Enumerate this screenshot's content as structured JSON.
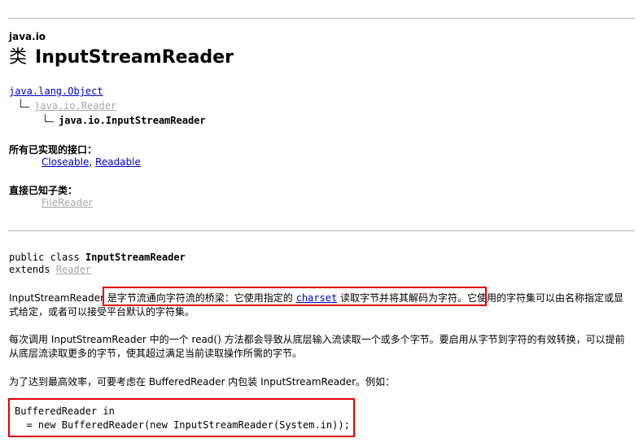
{
  "header": {
    "package": "java.io",
    "kind": "类",
    "class_name": "InputStreamReader"
  },
  "hierarchy": {
    "level1": "java.lang.Object",
    "level2": "java.io.Reader",
    "level3": "java.io.InputStreamReader"
  },
  "interfaces": {
    "label": "所有已实现的接口：",
    "items": [
      "Closeable",
      "Readable"
    ],
    "separator": ", "
  },
  "subclasses": {
    "label": "直接已知子类：",
    "items": [
      "FileReader"
    ]
  },
  "signature": {
    "line1_prefix": "public class ",
    "line1_name": "InputStreamReader",
    "line2_prefix": "extends ",
    "line2_link": "Reader"
  },
  "description": {
    "p1_start": "InputStreamReader ",
    "p1_highlight_a": "是字节流通向字符流的桥梁：它使用指定的 ",
    "p1_charset": "charset",
    "p1_highlight_b": " 读取字节并将其解码为字符。",
    "p1_rest": "它使用的字符集可以由名称指定或显式给定，或者可以接受平台默认的字符集。",
    "p2": "每次调用 InputStreamReader 中的一个 read() 方法都会导致从底层输入流读取一个或多个字节。要启用从字节到字符的有效转换，可以提前从底层流读取更多的字节，使其超过满足当前读取操作所需的字节。",
    "p3": "为了达到最高效率，可要考虑在 BufferedReader 内包装 InputStreamReader。例如：",
    "code_line1": "BufferedReader in",
    "code_line2": "  = new BufferedReader(new InputStreamReader(System.in));"
  },
  "colors": {
    "link": "#0000cc",
    "dim_link": "#a7a7a7",
    "highlight_box": "#e00000"
  }
}
